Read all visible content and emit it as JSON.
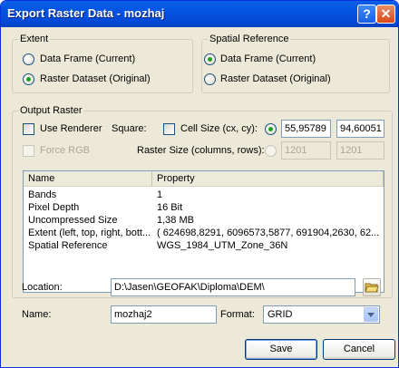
{
  "window": {
    "title": "Export Raster Data - mozhaj",
    "help_label": "?",
    "close_label": "✕"
  },
  "extent": {
    "legend": "Extent",
    "options": [
      {
        "label": "Data Frame (Current)",
        "selected": false
      },
      {
        "label": "Raster Dataset (Original)",
        "selected": true
      }
    ]
  },
  "spatial_reference": {
    "legend": "Spatial Reference",
    "options": [
      {
        "label": "Data Frame (Current)",
        "selected": true
      },
      {
        "label": "Raster Dataset (Original)",
        "selected": false
      }
    ]
  },
  "output_raster": {
    "legend": "Output Raster",
    "use_renderer_label": "Use Renderer",
    "force_rgb_label": "Force RGB",
    "square_label": "Square:",
    "cell_size_label": "Cell Size (cx, cy):",
    "cell_size_x": "55,95789",
    "cell_size_y": "94,60051",
    "raster_size_label": "Raster Size (columns, rows):",
    "raster_cols": "1201",
    "raster_rows": "1201"
  },
  "properties": {
    "columns": [
      "Name",
      "Property"
    ],
    "rows": [
      {
        "name": "Bands",
        "value": "1"
      },
      {
        "name": "Pixel Depth",
        "value": "16 Bit"
      },
      {
        "name": "Uncompressed Size",
        "value": "1,38 MB"
      },
      {
        "name": "Extent (left, top, right, bott...",
        "value": "( 624698,8291, 6096573,5877, 691904,2630, 62..."
      },
      {
        "name": "Spatial Reference",
        "value": "WGS_1984_UTM_Zone_36N"
      }
    ]
  },
  "location": {
    "label": "Location:",
    "value": "D:\\Jasen\\GEOFAK\\Diploma\\DEM\\"
  },
  "name_field": {
    "label": "Name:",
    "value": "mozhaj2"
  },
  "format": {
    "label": "Format:",
    "value": "GRID"
  },
  "buttons": {
    "save": "Save",
    "cancel": "Cancel"
  },
  "colors": {
    "titlebar": "#0553e0",
    "dialog_bg": "#ece9d8",
    "radio_dot": "#21a121"
  }
}
